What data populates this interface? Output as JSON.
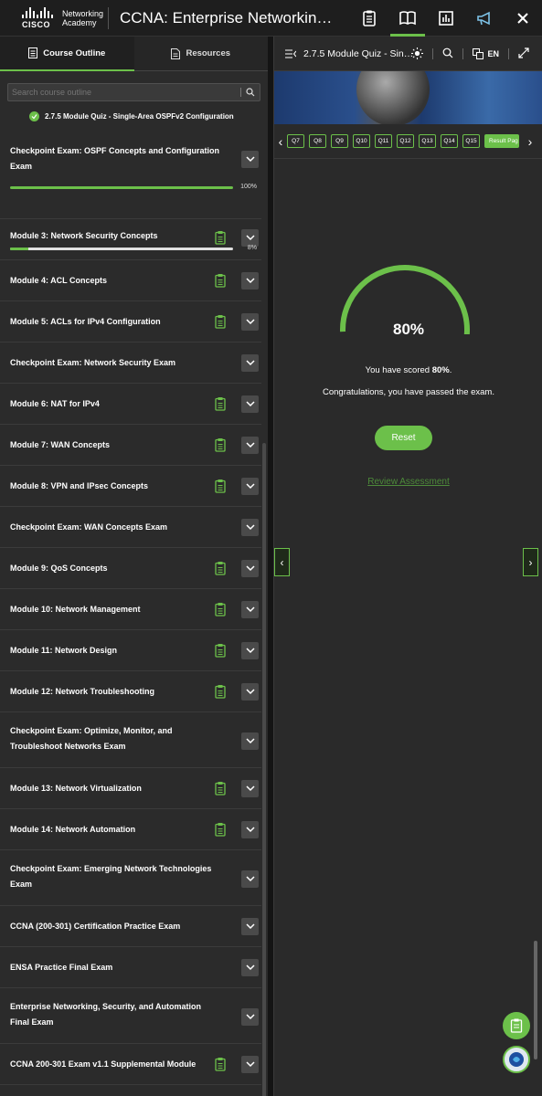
{
  "brand": {
    "line1": "Networking",
    "line2": "Academy",
    "wordmark": "CISCO"
  },
  "app_title": "CCNA: Enterprise Networking,...",
  "colors": {
    "accent": "#6cc04a",
    "panel_bg": "#2b2b2b",
    "header_bg": "#1e1e1e"
  },
  "top_icons": [
    "clipboard-icon",
    "book-icon",
    "chart-icon",
    "megaphone-icon",
    "close-icon"
  ],
  "tabs": [
    {
      "label": "Course Outline",
      "icon": "outline-icon",
      "active": true
    },
    {
      "label": "Resources",
      "icon": "document-icon",
      "active": false
    }
  ],
  "search": {
    "placeholder": "Search course outline"
  },
  "current_item": "2.7.5 Module Quiz - Single-Area OSPFv2 Configuration",
  "outline": [
    {
      "title": "Checkpoint Exam: OSPF Concepts and Configuration Exam",
      "progress": "100%",
      "has_clip": false
    },
    {
      "title": "Module 3: Network Security Concepts",
      "progress": "8%",
      "has_clip": true
    },
    {
      "title": "Module 4: ACL Concepts",
      "has_clip": true
    },
    {
      "title": "Module 5: ACLs for IPv4 Configuration",
      "has_clip": true
    },
    {
      "title": "Checkpoint Exam: Network Security Exam",
      "has_clip": false
    },
    {
      "title": "Module 6: NAT for IPv4",
      "has_clip": true
    },
    {
      "title": "Module 7: WAN Concepts",
      "has_clip": true
    },
    {
      "title": "Module 8: VPN and IPsec Concepts",
      "has_clip": true
    },
    {
      "title": "Checkpoint Exam: WAN Concepts Exam",
      "has_clip": false
    },
    {
      "title": "Module 9: QoS Concepts",
      "has_clip": true
    },
    {
      "title": "Module 10: Network Management",
      "has_clip": true
    },
    {
      "title": "Module 11: Network Design",
      "has_clip": true
    },
    {
      "title": "Module 12: Network Troubleshooting",
      "has_clip": true
    },
    {
      "title": "Checkpoint Exam: Optimize, Monitor, and Troubleshoot Networks Exam",
      "has_clip": false
    },
    {
      "title": "Module 13: Network Virtualization",
      "has_clip": true
    },
    {
      "title": "Module 14: Network Automation",
      "has_clip": true
    },
    {
      "title": "Checkpoint Exam: Emerging Network Technologies Exam",
      "has_clip": false
    },
    {
      "title": "CCNA (200-301) Certification Practice Exam",
      "has_clip": false
    },
    {
      "title": "ENSA Practice Final Exam",
      "has_clip": false
    },
    {
      "title": "Enterprise Networking, Security, and Automation Final Exam",
      "has_clip": false
    },
    {
      "title": "CCNA 200-301 Exam v1.1 Supplemental Module",
      "has_clip": true
    }
  ],
  "quiz": {
    "title": "2.7.5 Module Quiz - Single-...",
    "language": "EN",
    "questions": [
      "Q7",
      "Q8",
      "Q9",
      "Q10",
      "Q11",
      "Q12",
      "Q13",
      "Q14",
      "Q15"
    ],
    "result_label": "Result Page",
    "score": 0.8,
    "score_text": "80%",
    "scored_prefix": "You have scored ",
    "scored_value": "80%",
    "scored_suffix": ".",
    "passed_msg": "Congratulations, you have passed the exam.",
    "reset_label": "Reset",
    "review_label": "Review Assessment"
  }
}
